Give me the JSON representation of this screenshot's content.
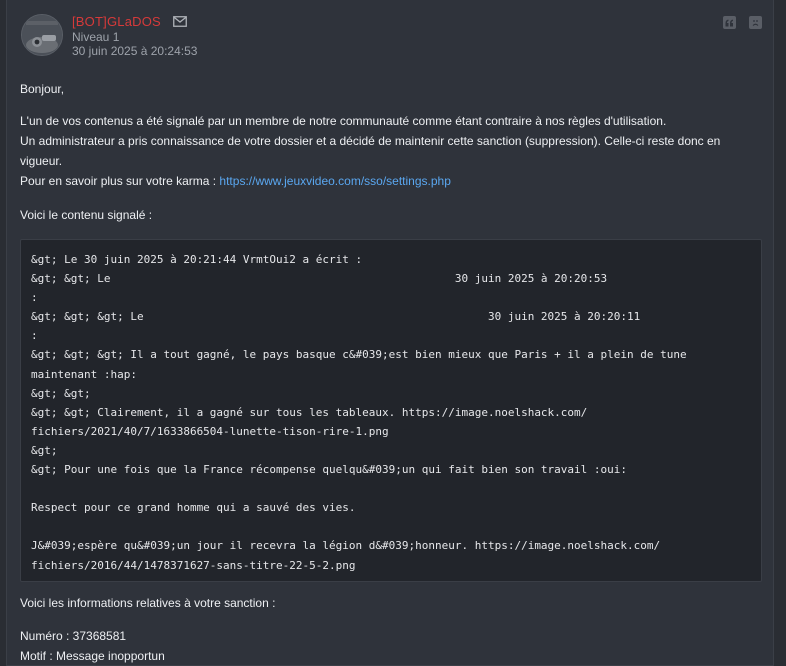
{
  "post": {
    "author": "[BOT]GLaDOS",
    "level": "Niveau 1",
    "date": "30 juin 2025 à 20:24:53",
    "icons": {
      "mail": "envelope-icon",
      "quote": "quote-icon",
      "report": "sad-face-icon"
    }
  },
  "message": {
    "greeting": "Bonjour,",
    "p1_line1": "L'un de vos contenus a été signalé par un membre de notre communauté comme étant contraire à nos règles d'utilisation.",
    "p1_line2": "Un administrateur a pris connaissance de votre dossier et a décidé de maintenir cette sanction (suppression). Celle-ci reste donc en",
    "p1_line3": "vigueur.",
    "karma_prefix": "Pour en savoir plus sur votre karma : ",
    "karma_link": "https://www.jeuxvideo.com/sso/settings.php",
    "reported_intro": "Voici le contenu signalé :",
    "quote_lines": [
      "&gt; Le 30 juin 2025 à 20:21:44 VrmtOui2 a écrit :",
      "&gt; &gt; Le                                                    30 juin 2025 à 20:20:53",
      ":",
      "&gt; &gt; &gt; Le                                                    30 juin 2025 à 20:20:11",
      ":",
      "&gt; &gt; &gt; Il a tout gagné, le pays basque c&#039;est bien mieux que Paris + il a plein de tune",
      "maintenant :hap:",
      "&gt; &gt;",
      "&gt; &gt; Clairement, il a gagné sur tous les tableaux. https://image.noelshack.com/",
      "fichiers/2021/40/7/1633866504-lunette-tison-rire-1.png",
      "&gt;",
      "&gt; Pour une fois que la France récompense quelqu&#039;un qui fait bien son travail :oui:",
      "",
      "Respect pour ce grand homme qui a sauvé des vies.",
      "",
      "J&#039;espère qu&#039;un jour il recevra la légion d&#039;honneur. https://image.noelshack.com/",
      "fichiers/2016/44/1478371627-sans-titre-22-5-2.png"
    ],
    "sanction_intro": "Voici les informations relatives à votre sanction :",
    "numero": "Numéro : 37368581",
    "motif": "Motif : Message inopportun"
  }
}
